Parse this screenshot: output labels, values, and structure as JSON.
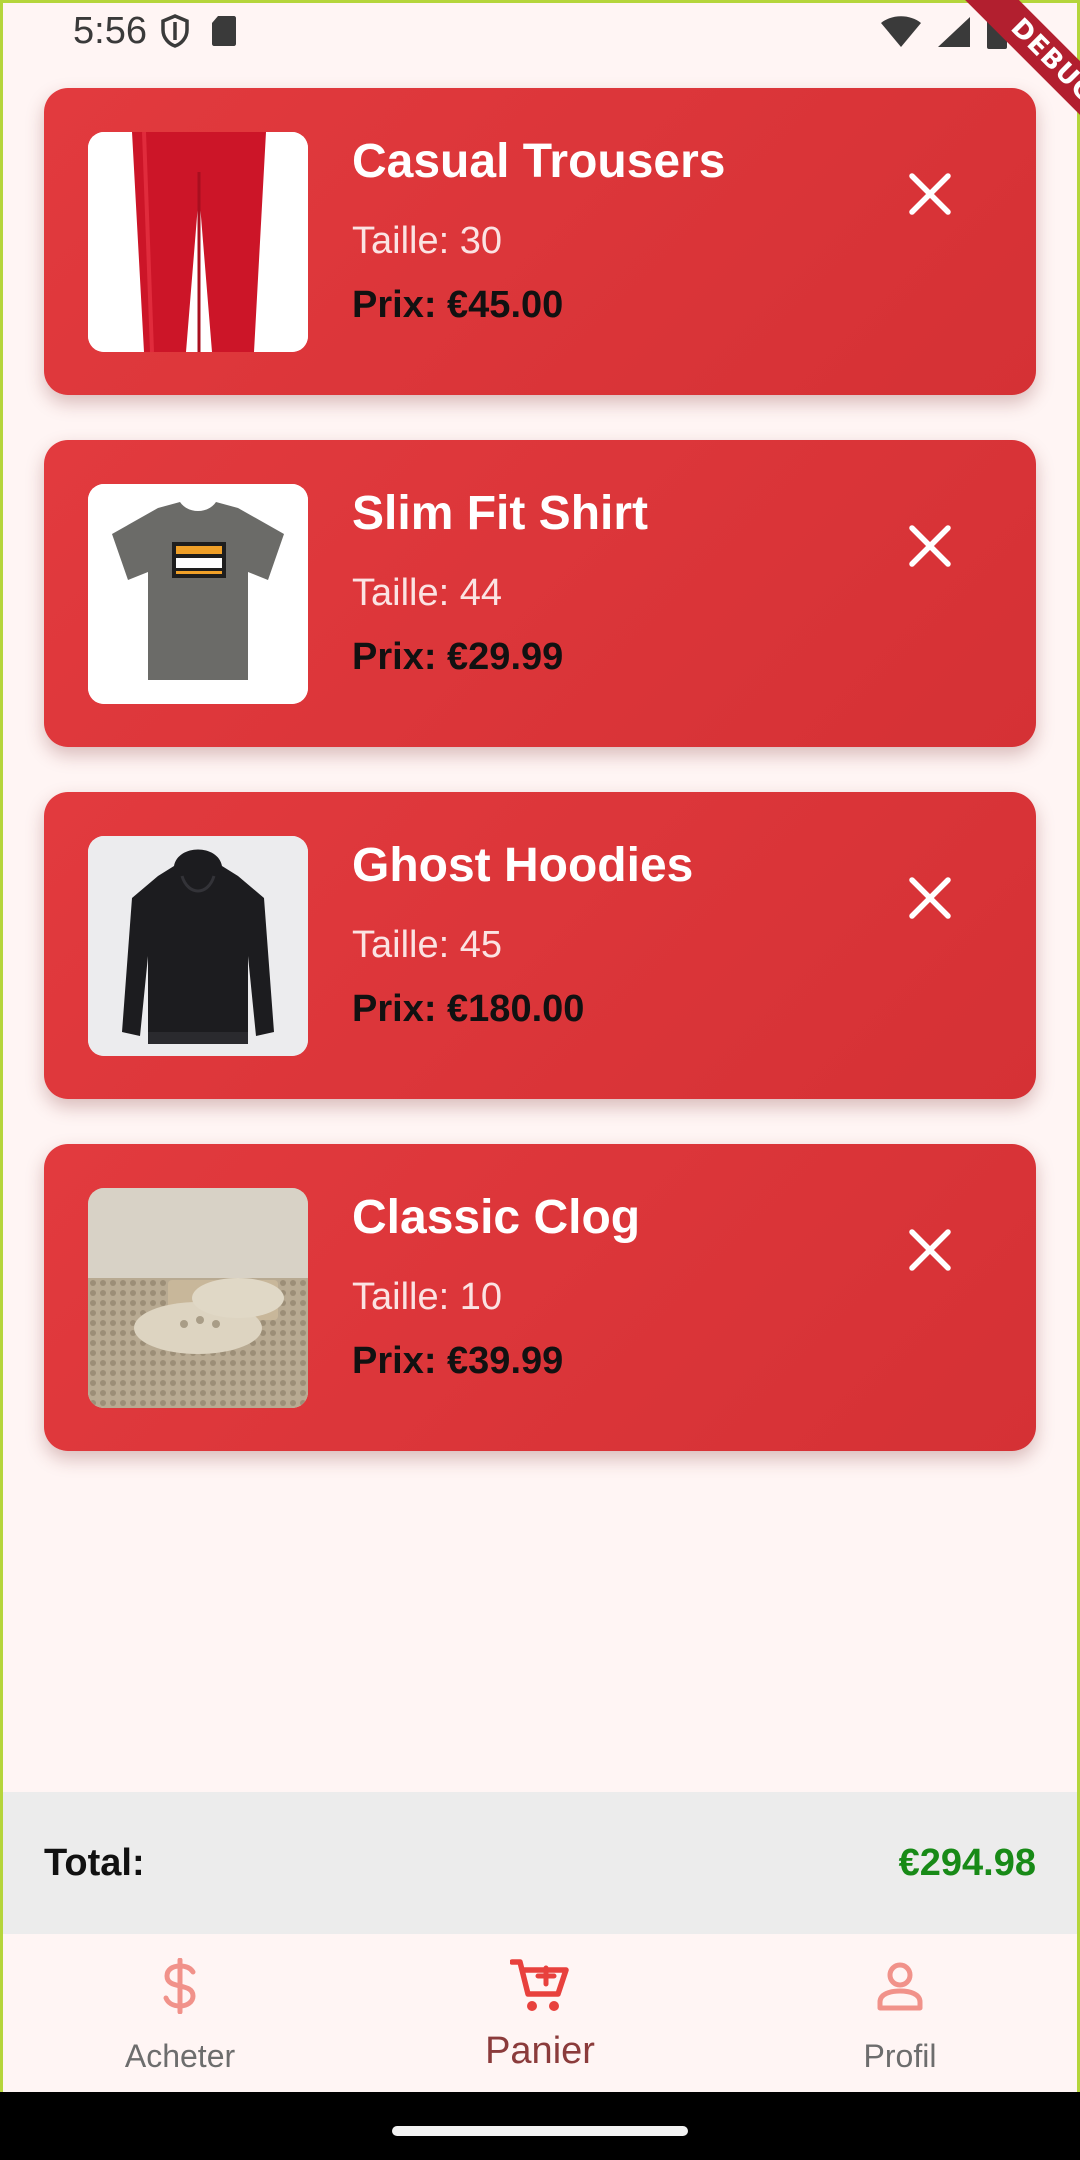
{
  "status_bar": {
    "time": "5:56"
  },
  "debug_banner": {
    "label": "DEBUG"
  },
  "cart": {
    "items": [
      {
        "name": "Casual Trousers",
        "size": "Taille: 30",
        "price": "Prix: €45.00",
        "image": "red-trousers"
      },
      {
        "name": "Slim Fit Shirt",
        "size": "Taille: 44",
        "price": "Prix: €29.99",
        "image": "grey-tshirt-do-not-disturb"
      },
      {
        "name": "Ghost Hoodies",
        "size": "Taille: 45",
        "price": "Prix: €180.00",
        "image": "black-hoodie"
      },
      {
        "name": "Classic Clog",
        "size": "Taille: 10",
        "price": "Prix: €39.99",
        "image": "beige-clogs"
      }
    ]
  },
  "total": {
    "label": "Total:",
    "value": "€294.98"
  },
  "bottom_nav": {
    "items": [
      {
        "label": "Acheter",
        "icon": "dollar-icon"
      },
      {
        "label": "Panier",
        "icon": "cart-icon"
      },
      {
        "label": "Profil",
        "icon": "person-icon"
      }
    ],
    "active_index": 1
  },
  "colors": {
    "card": "#dc3337",
    "accent": "#e8413d",
    "total_value": "#188a17",
    "background": "#fff5f4"
  }
}
